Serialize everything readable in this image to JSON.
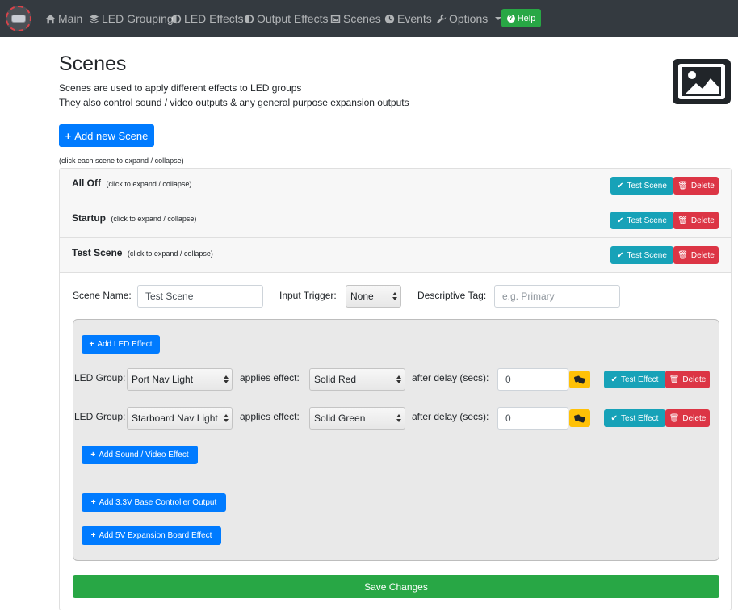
{
  "nav": {
    "items": [
      {
        "label": "Main",
        "icon": "home-icon"
      },
      {
        "label": "LED Grouping",
        "icon": "layers-icon"
      },
      {
        "label": "LED Effects",
        "icon": "half-circle-icon"
      },
      {
        "label": "Output Effects",
        "icon": "half-circle-icon"
      },
      {
        "label": "Scenes",
        "icon": "image-icon"
      },
      {
        "label": "Events",
        "icon": "clock-icon"
      },
      {
        "label": "Options",
        "icon": "wrench-icon"
      }
    ],
    "help_label": "Help"
  },
  "page": {
    "title": "Scenes",
    "desc_line1": "Scenes are used to apply different effects to LED groups",
    "desc_line2": "They also control sound / video outputs & any general purpose expansion outputs",
    "add_scene_label": "Add new Scene",
    "hint": "(click each scene to expand / collapse)"
  },
  "scenes": [
    {
      "name": "All Off",
      "sub": "(click to expand / collapse)",
      "test_label": "Test Scene",
      "delete_label": "Delete"
    },
    {
      "name": "Startup",
      "sub": "(click to expand / collapse)",
      "test_label": "Test Scene",
      "delete_label": "Delete"
    },
    {
      "name": "Test Scene",
      "sub": "(click to expand / collapse)",
      "test_label": "Test Scene",
      "delete_label": "Delete"
    }
  ],
  "scene_detail": {
    "name_label": "Scene Name:",
    "name_value": "Test Scene",
    "trigger_label": "Input Trigger:",
    "trigger_value": "None",
    "tag_label": "Descriptive Tag:",
    "tag_placeholder": "e.g. Primary",
    "add_led_effect_label": "Add LED Effect",
    "effects": [
      {
        "group_label": "LED Group:",
        "group": "Port Nav Light",
        "applies_label": "applies effect:",
        "effect": "Solid Red",
        "delay_label": "after delay (secs):",
        "delay": "0",
        "test_label": "Test Effect",
        "delete_label": "Delete"
      },
      {
        "group_label": "LED Group:",
        "group": "Starboard Nav Light",
        "applies_label": "applies effect:",
        "effect": "Solid Green",
        "delay_label": "after delay (secs):",
        "delay": "0",
        "test_label": "Test Effect",
        "delete_label": "Delete"
      }
    ],
    "add_sound_label": "Add Sound / Video Effect",
    "add_base_output_label": "Add 3.3V Base Controller Output",
    "add_expansion_label": "Add 5V Expansion Board Effect",
    "save_label": "Save Changes"
  },
  "colors": {
    "navbar": "#343a40",
    "primary": "#007bff",
    "info": "#17a2b8",
    "danger": "#dc3545",
    "warning": "#ffc107",
    "success": "#28a745"
  }
}
